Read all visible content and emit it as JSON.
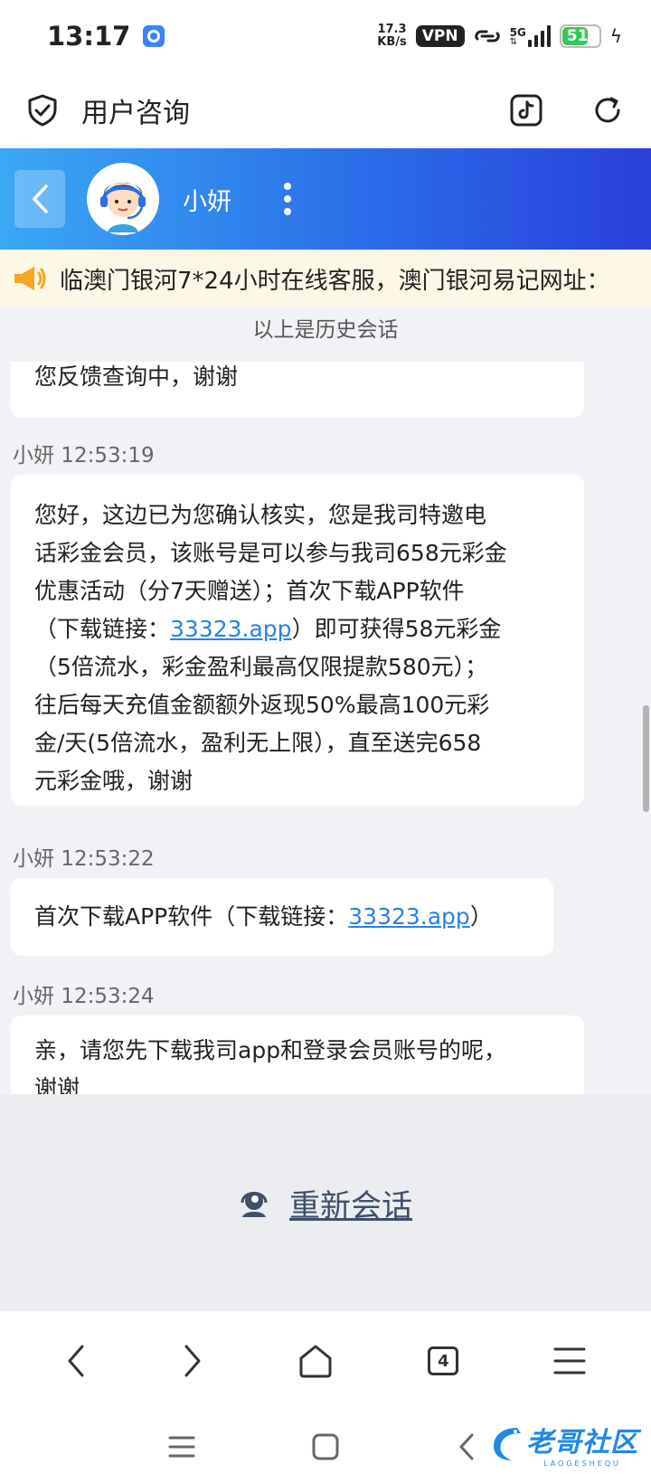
{
  "status_bar": {
    "time": "13:17",
    "net_speed_value": "17.3",
    "net_speed_unit": "KB/s",
    "vpn": "VPN",
    "network": "5G",
    "battery": "51"
  },
  "top_bar": {
    "title": "用户咨询"
  },
  "chat_header": {
    "agent_name": "小妍"
  },
  "notice": {
    "text": "临澳门银河7*24小时在线客服，澳门银河易记网址："
  },
  "history_label": "以上是历史会话",
  "messages": [
    {
      "text": "您反馈查询中，谢谢"
    },
    {
      "sender": "小妍 12:53:19",
      "lines": [
        "您好，这边已为您确认核实，您是我司特邀电",
        "话彩金会员，该账号是可以参与我司658元彩金",
        "优惠活动（分7天赠送）；首次下载APP软件",
        "（下载链接：",
        "33323.app",
        "）即可获得58元彩金",
        "（5倍流水，彩金盈利最高仅限提款580元）；",
        "往后每天充值金额额外返现50%最高100元彩",
        "金/天(5倍流水，盈利无上限），直至送完658",
        "元彩金哦，谢谢"
      ]
    },
    {
      "sender": "小妍 12:53:22",
      "prefix": "首次下载APP软件（下载链接：",
      "link": "33323.app",
      "suffix": "）"
    },
    {
      "sender": "小妍 12:53:24",
      "lines": [
        "亲，请您先下载我司app和登录会员账号的呢，",
        "谢谢"
      ]
    }
  ],
  "restart": {
    "label": "重新会话"
  },
  "browser_nav": {
    "tab_count": "4"
  },
  "watermark": {
    "text": "老哥社区",
    "sub": "LAOGESHEQU"
  }
}
